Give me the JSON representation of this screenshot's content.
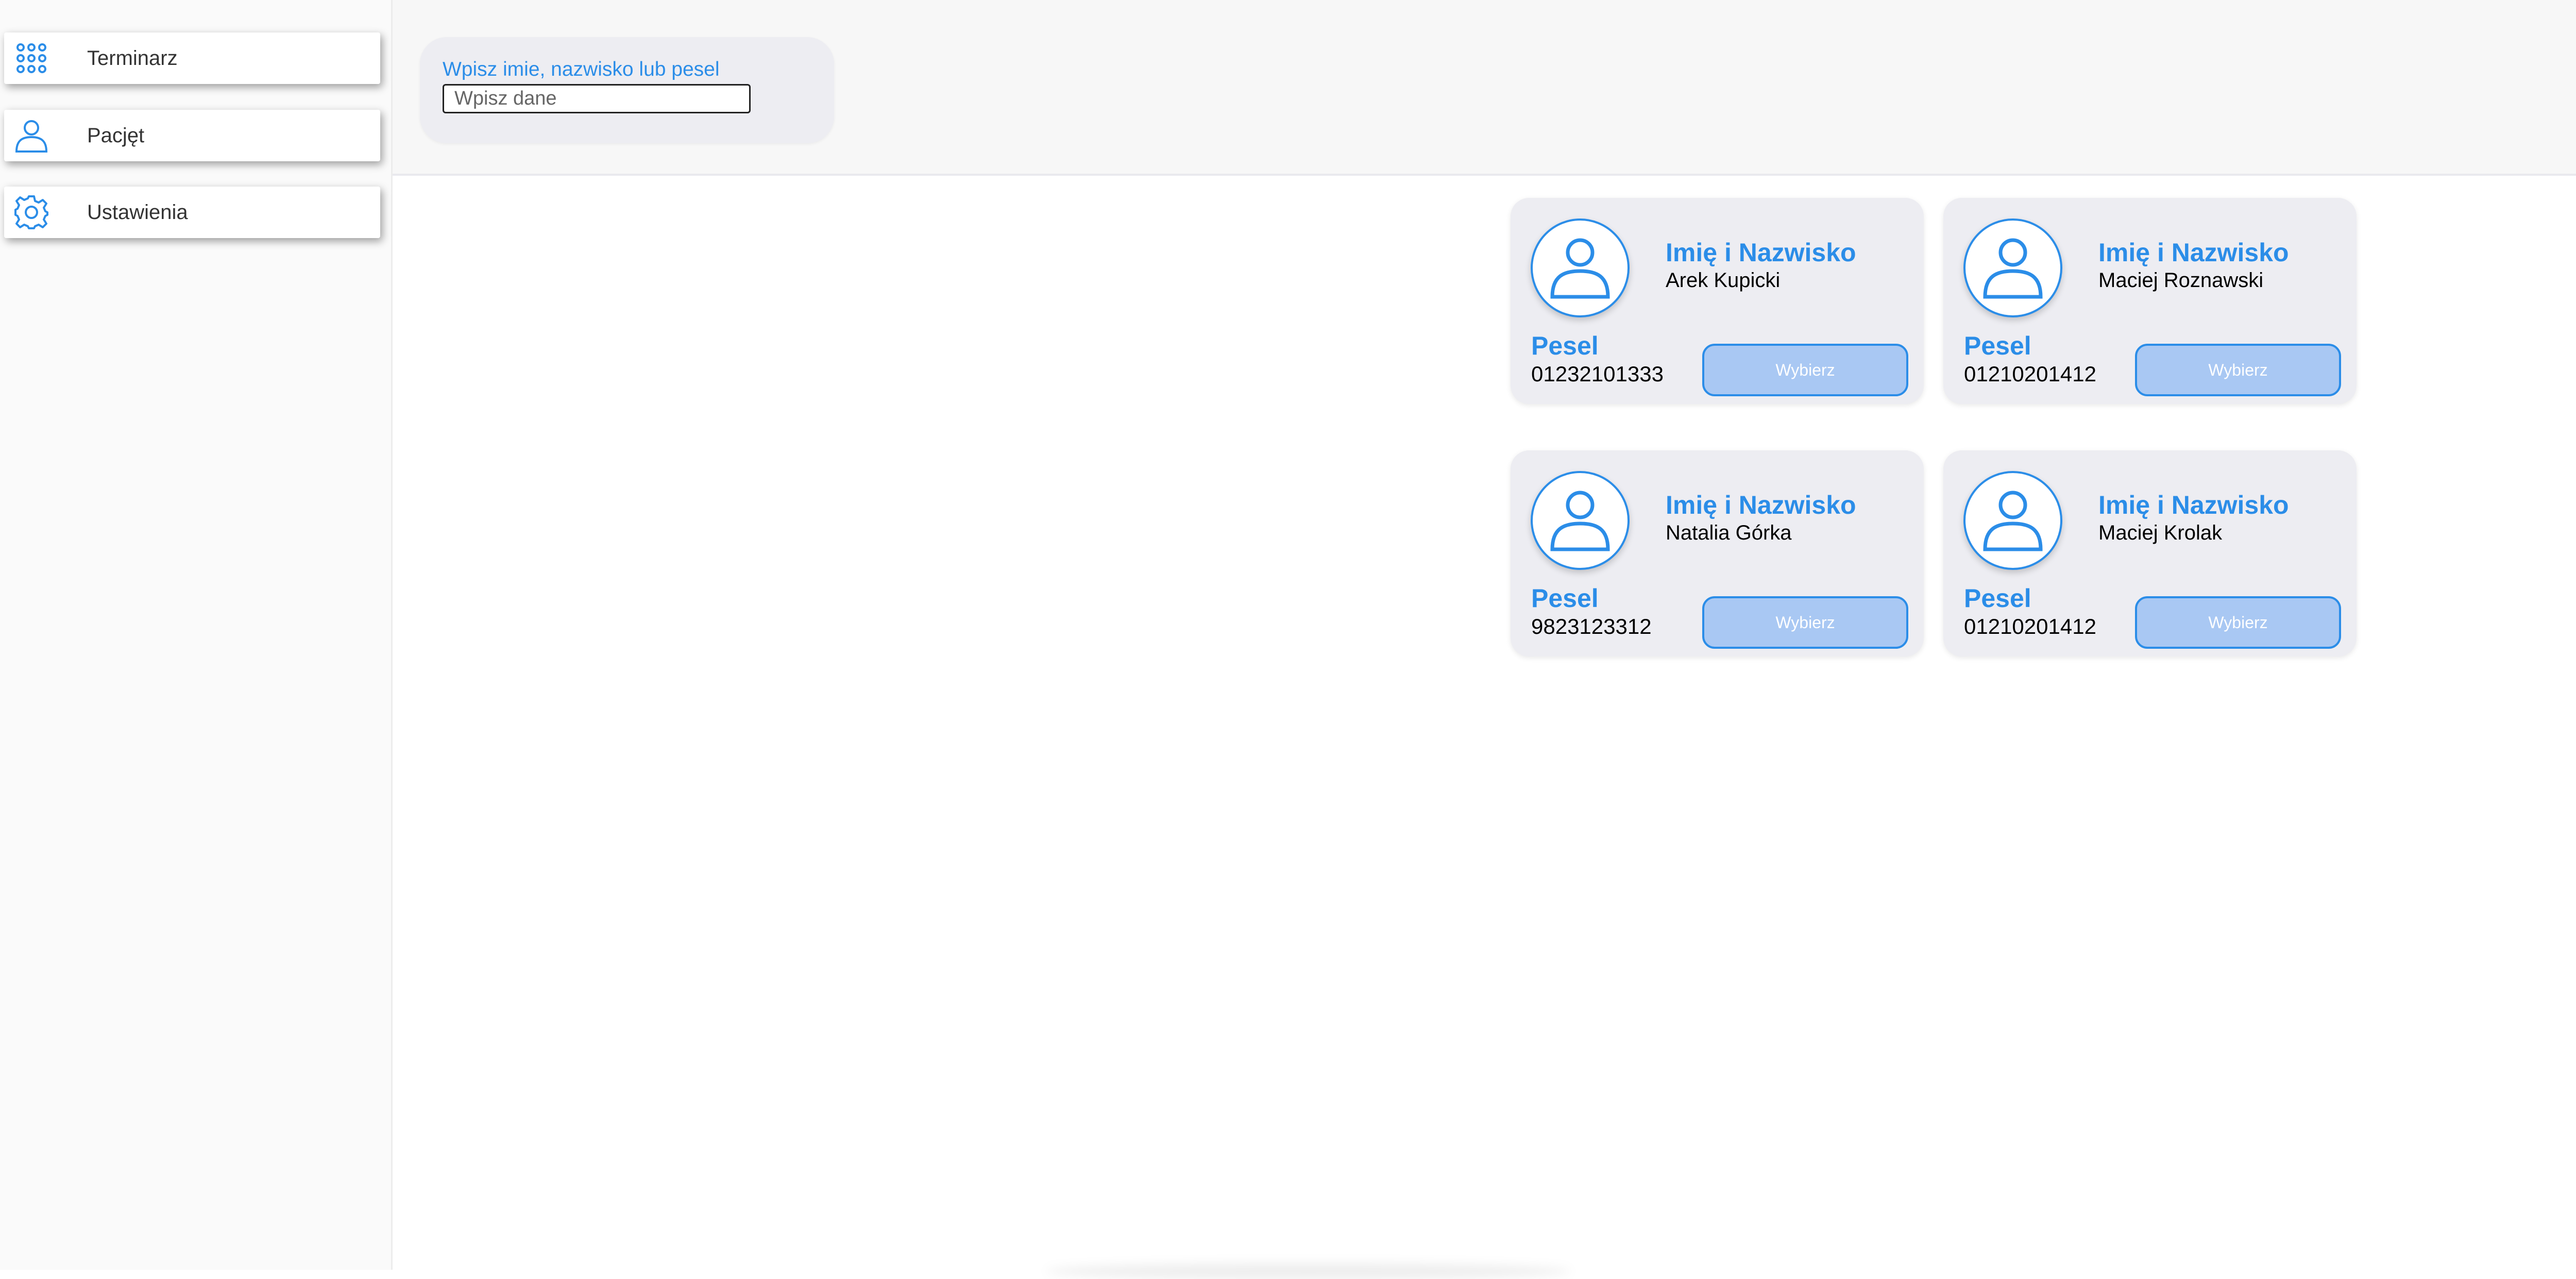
{
  "sidebar": {
    "items": [
      {
        "label": "Terminarz",
        "icon": "grid-icon"
      },
      {
        "label": "Pacjęt",
        "icon": "user-icon"
      },
      {
        "label": "Ustawienia",
        "icon": "gear-icon"
      }
    ]
  },
  "search": {
    "label": "Wpisz imie, nazwisko lub pesel",
    "placeholder": "Wpisz dane",
    "value": ""
  },
  "patients": [
    {
      "name_heading": "Imię i Nazwisko",
      "name": "Arek Kupicki",
      "pesel_heading": "Pesel",
      "pesel": "01232101333",
      "button_label": "Wybierz"
    },
    {
      "name_heading": "Imię i Nazwisko",
      "name": "Maciej Roznawski",
      "pesel_heading": "Pesel",
      "pesel": "01210201412",
      "button_label": "Wybierz"
    },
    {
      "name_heading": "Imię i Nazwisko",
      "name": "Natalia Górka",
      "pesel_heading": "Pesel",
      "pesel": "9823123312",
      "button_label": "Wybierz"
    },
    {
      "name_heading": "Imię i Nazwisko",
      "name": "Maciej Krolak",
      "pesel_heading": "Pesel",
      "pesel": "01210201412",
      "button_label": "Wybierz"
    }
  ],
  "colors": {
    "accent": "#2b8de8",
    "button_fill": "#a9c8f3",
    "card_bg": "#ededf2"
  }
}
